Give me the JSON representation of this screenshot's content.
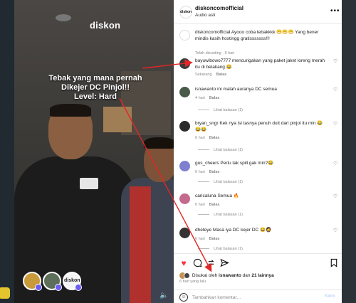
{
  "video": {
    "brand": "diskon",
    "overlay_lines": [
      "Tebak yang mana pernah",
      "Dikejer DC Pinjol!!",
      "Level: Hard"
    ],
    "story_avatar_label": "diskon"
  },
  "header": {
    "username": "diskoncomofficial",
    "subtitle": "Audio asli",
    "logo_label": "diskon"
  },
  "caption": {
    "username": "diskoncomofficial",
    "text": "Ayooo coba tebakkkk 😁😁😁 Yang bener mindis kasih hostingg gratisssssss!!!",
    "meta": "Telah disunting · 6 hari"
  },
  "comments": [
    {
      "username": "bayuwibowo7777",
      "text": "mencurigakan yang paket jaket loreng merah itu di belakang 😂",
      "time": "Sekarang",
      "reply": "Balas",
      "replies_label": "",
      "avatar_color": "#3a3a3a"
    },
    {
      "username": "isnawanto",
      "text": "ini malah auranya DC semua",
      "time": "4 hari",
      "reply": "Balas",
      "replies_label": "Lihat balasan (1)",
      "avatar_color": "#4a5a4a"
    },
    {
      "username": "bryan_sngr",
      "text": "Kek nya isi tasnya penuh duit dari pinjol itu min 😂 😂😂",
      "time": "6 hari",
      "reply": "Balas",
      "replies_label": "Lihat balasan (1)",
      "avatar_color": "#2b2b2b"
    },
    {
      "username": "gus_cheers",
      "text": "Perlu tak spill gak min?😂",
      "time": "6 hari",
      "reply": "Balas",
      "replies_label": "Lihat balasan (1)",
      "avatar_color": "#7f7fd0"
    },
    {
      "username": "caricaluna",
      "text": "Semua 🔥",
      "time": "6 hari",
      "reply": "Balas",
      "replies_label": "Lihat balasan (1)",
      "avatar_color": "#c46a8c"
    },
    {
      "username": "dheteye",
      "text": "Masa iya DC kejer DC 😂🧔",
      "time": "6 hari",
      "reply": "Balas",
      "replies_label": "Lihat balasan (1)",
      "avatar_color": "#333333"
    }
  ],
  "actions": {
    "liked_by_prefix": "Disukai oleh",
    "liked_by_user": "isnawanto",
    "liked_by_and": "dan",
    "liked_by_others": "21 lainnya",
    "time_ago": "6 hari yang lalu",
    "comment_placeholder": "Tambahkan komentar…",
    "post_label": "Kirim"
  },
  "colors": {
    "heart_liked": "#ff3040",
    "annotation": "#e32626",
    "post_disabled": "#a9c8f5"
  }
}
